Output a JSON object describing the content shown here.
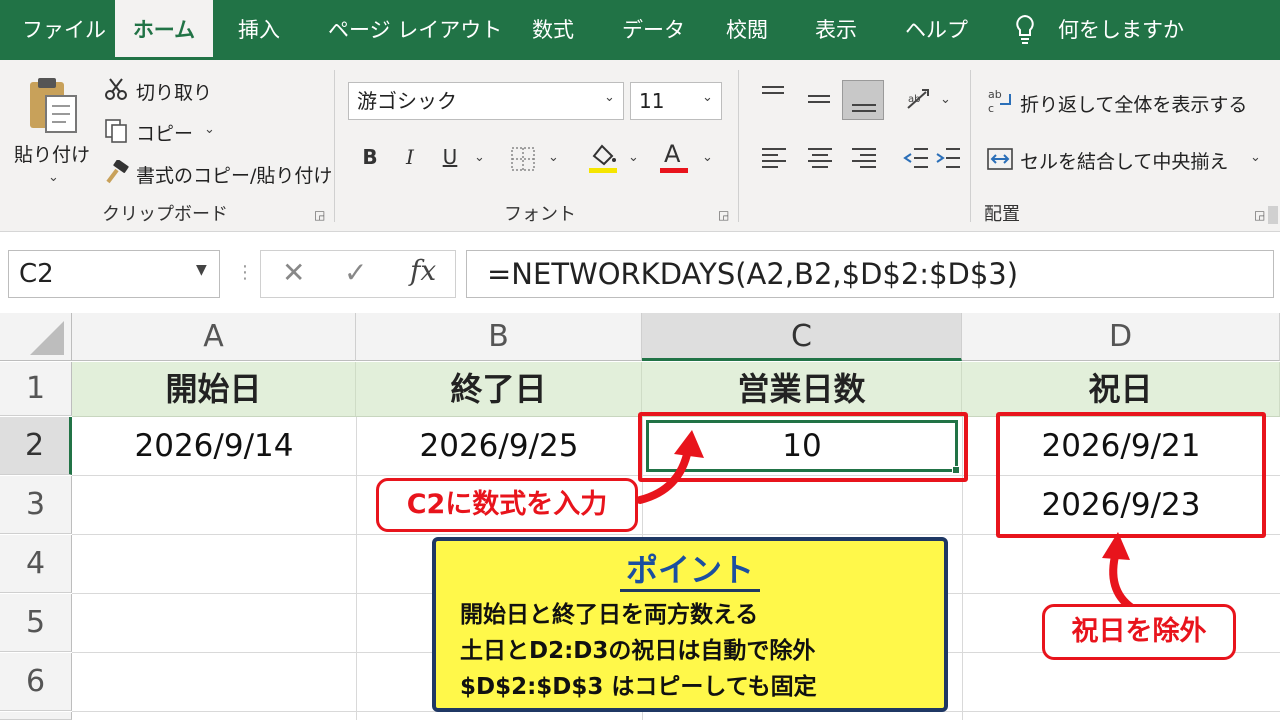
{
  "tabs": [
    {
      "label": "ファイル"
    },
    {
      "label": "ホーム"
    },
    {
      "label": "挿入"
    },
    {
      "label": "ページ レイアウト"
    },
    {
      "label": "数式"
    },
    {
      "label": "データ"
    },
    {
      "label": "校閲"
    },
    {
      "label": "表示"
    },
    {
      "label": "ヘルプ"
    }
  ],
  "tellme": "何をしますか",
  "clipboard": {
    "paste": "貼り付け",
    "cut": "切り取り",
    "copy": "コピー",
    "format_painter": "書式のコピー/貼り付け",
    "title": "クリップボード"
  },
  "font": {
    "name": "游ゴシック",
    "size": "11",
    "bold": "B",
    "italic": "I",
    "underline": "U",
    "color_letter": "A",
    "title": "フォント",
    "fill_color": "#f5e500",
    "font_color": "#e8141c"
  },
  "alignment": {
    "wrap": "折り返して全体を表示する",
    "merge": "セルを結合して中央揃え",
    "title": "配置"
  },
  "formula_bar": {
    "name_box": "C2",
    "fx": "fx",
    "formula": "=NETWORKDAYS(A2,B2,$D$2:$D$3)"
  },
  "columns": [
    "A",
    "B",
    "C",
    "D"
  ],
  "rows": [
    "1",
    "2",
    "3",
    "4",
    "5",
    "6"
  ],
  "sheet": {
    "headers": [
      "開始日",
      "終了日",
      "営業日数",
      "祝日"
    ],
    "a2": "2026/9/14",
    "b2": "2026/9/25",
    "c2": "10",
    "d2": "2026/9/21",
    "d3": "2026/9/23"
  },
  "annotations": {
    "c2_callout": "C2に数式を入力",
    "holiday_callout": "祝日を除外",
    "point_title": "ポイント",
    "point_lines": [
      "開始日と終了日を両方数える",
      "土日とD2:D3の祝日は自動で除外",
      "$D$2:$D$3 はコピーしても固定"
    ]
  },
  "colors": {
    "excel_green": "#217346",
    "header_fill": "#e2efda",
    "highlight_red": "#e8141c",
    "point_fill": "#fff84a",
    "point_border": "#1f3864"
  }
}
